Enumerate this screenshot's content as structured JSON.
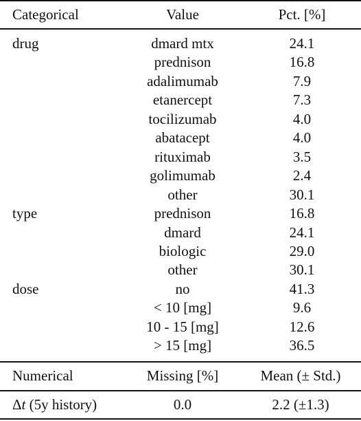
{
  "table": {
    "categorical_header": {
      "col1": "Categorical",
      "col2": "Value",
      "col3": "Pct. [%]"
    },
    "categorical_rows": [
      {
        "category": "drug",
        "value": "dmard mtx",
        "pct": "24.1"
      },
      {
        "category": "",
        "value": "prednison",
        "pct": "16.8"
      },
      {
        "category": "",
        "value": "adalimumab",
        "pct": "7.9"
      },
      {
        "category": "",
        "value": "etanercept",
        "pct": "7.3"
      },
      {
        "category": "",
        "value": "tocilizumab",
        "pct": "4.0"
      },
      {
        "category": "",
        "value": "abatacept",
        "pct": "4.0"
      },
      {
        "category": "",
        "value": "rituximab",
        "pct": "3.5"
      },
      {
        "category": "",
        "value": "golimumab",
        "pct": "2.4"
      },
      {
        "category": "",
        "value": "other",
        "pct": "30.1"
      },
      {
        "category": "type",
        "value": "prednison",
        "pct": "16.8"
      },
      {
        "category": "",
        "value": "dmard",
        "pct": "24.1"
      },
      {
        "category": "",
        "value": "biologic",
        "pct": "29.0"
      },
      {
        "category": "",
        "value": "other",
        "pct": "30.1"
      },
      {
        "category": "dose",
        "value": "no",
        "pct": "41.3"
      },
      {
        "category": "",
        "value": "< 10 [mg]",
        "pct": "9.6"
      },
      {
        "category": "",
        "value": "10 - 15 [mg]",
        "pct": "12.6"
      },
      {
        "category": "",
        "value": "> 15 [mg]",
        "pct": "36.5"
      }
    ],
    "numerical_header": {
      "col1": "Numerical",
      "col2": "Missing [%]",
      "col3": "Mean (± Std.)"
    },
    "numerical_rows": [
      {
        "delta_symbol": "Δ",
        "var_symbol": "t",
        "name_suffix": " (5y history)",
        "missing": "0.0",
        "mean_std": "2.2 (±1.3)"
      }
    ]
  }
}
